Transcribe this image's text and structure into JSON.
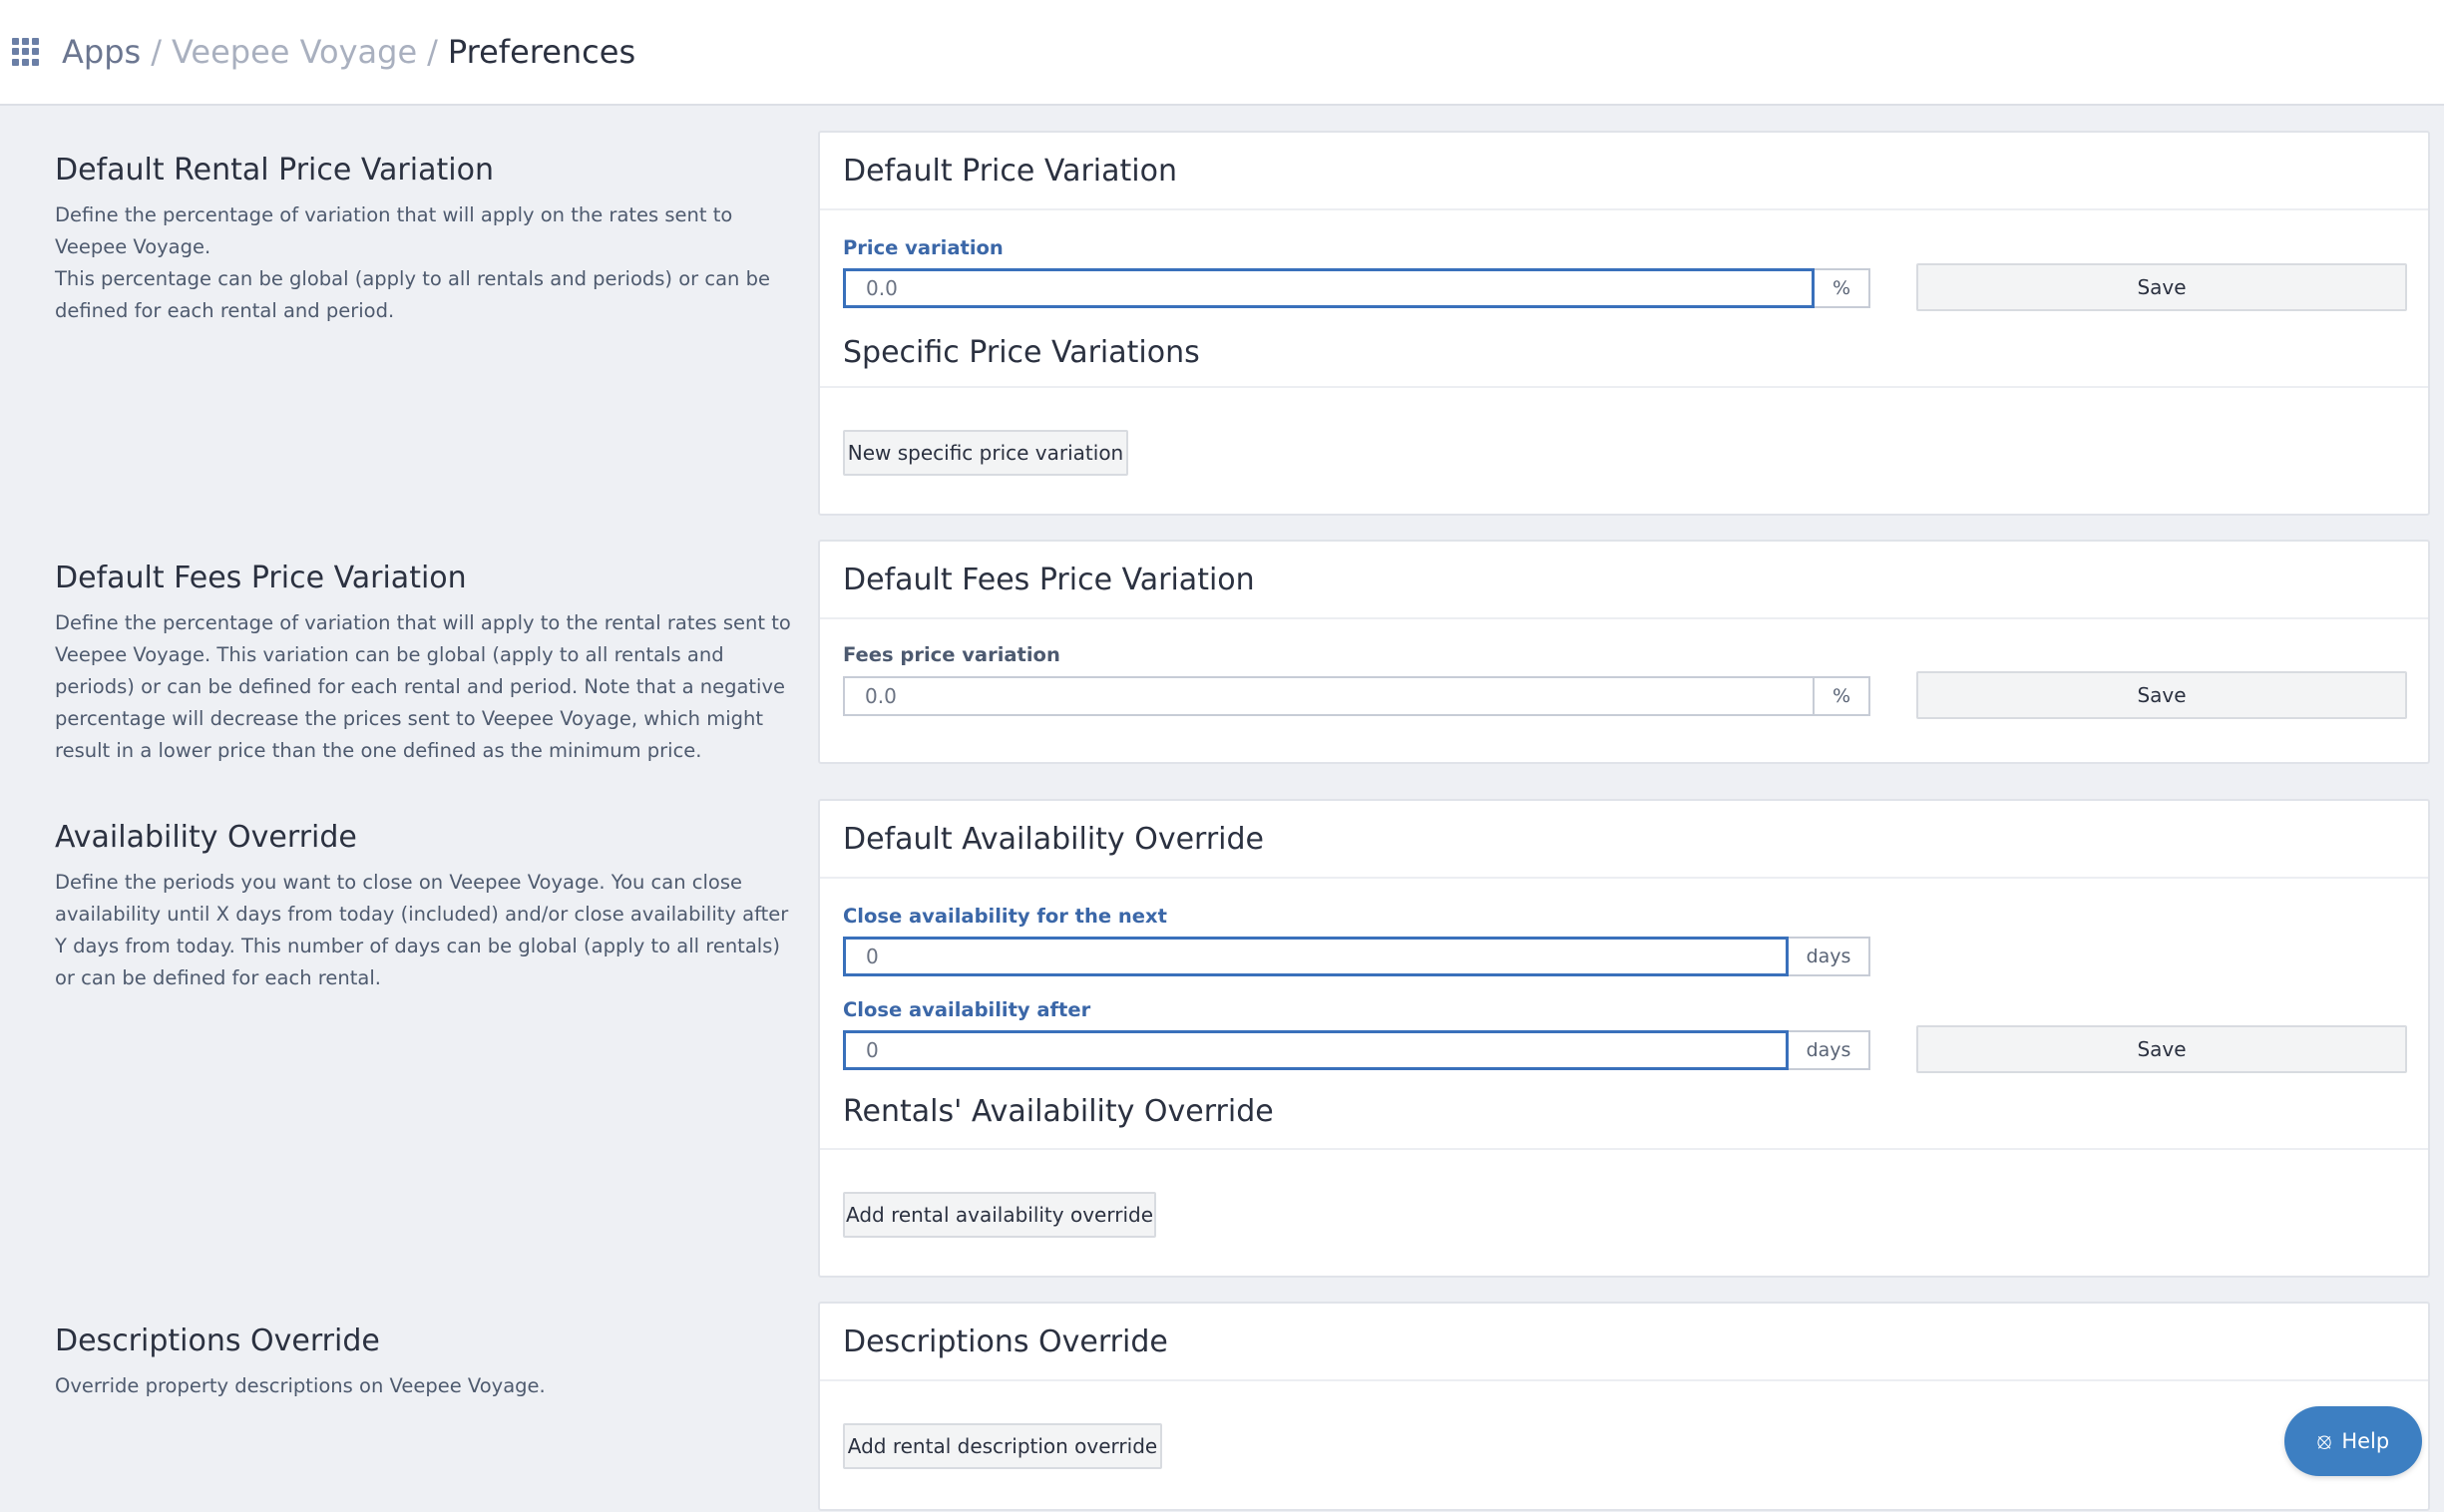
{
  "breadcrumb": {
    "apps": "Apps",
    "app_name": "Veepee Voyage",
    "current": "Preferences",
    "separator": "/"
  },
  "sections": {
    "rental_price": {
      "title": "Default Rental Price Variation",
      "desc1": "Define the percentage of variation that will apply on the rates sent to Veepee Voyage.",
      "desc2": "This percentage can be global (apply to all rentals and periods) or can be defined for each rental and period."
    },
    "fees_price": {
      "title": "Default Fees Price Variation",
      "desc": "Define the percentage of variation that will apply to the rental rates sent to Veepee Voyage. This variation can be global (apply to all rentals and periods) or can be defined for each rental and period. Note that a negative percentage will decrease the prices sent to Veepee Voyage, which might result in a lower price than the one defined as the minimum price."
    },
    "availability": {
      "title": "Availability Override",
      "desc": "Define the periods you want to close on Veepee Voyage. You can close availability until X days from today (included) and/or close availability after Y days from today. This number of days can be global (apply to all rentals) or can be defined for each rental."
    },
    "descriptions": {
      "title": "Descriptions Override",
      "desc": "Override property descriptions on Veepee Voyage."
    }
  },
  "cards": {
    "price": {
      "title": "Default Price Variation",
      "label": "Price variation",
      "value": "0.0",
      "unit": "%",
      "save": "Save",
      "specific_title": "Specific Price Variations",
      "new_button": "New specific price variation"
    },
    "fees": {
      "title": "Default Fees Price Variation",
      "label": "Fees price variation",
      "value": "0.0",
      "unit": "%",
      "save": "Save"
    },
    "availability": {
      "title": "Default Availability Override",
      "next_label": "Close availability for the next",
      "next_value": "0",
      "after_label": "Close availability after",
      "after_value": "0",
      "unit": "days",
      "save": "Save",
      "rentals_title": "Rentals' Availability Override",
      "add_button": "Add rental availability override"
    },
    "descriptions": {
      "title": "Descriptions Override",
      "add_button": "Add rental description override"
    }
  },
  "help": {
    "label": "Help"
  }
}
